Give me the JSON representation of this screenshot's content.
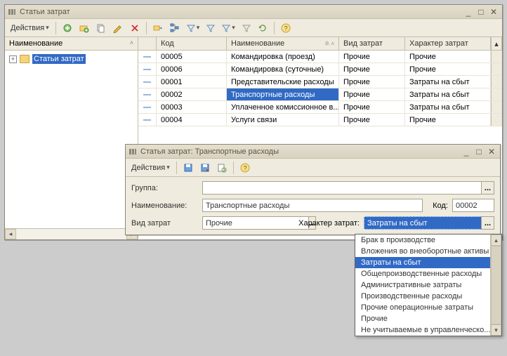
{
  "mainWindow": {
    "title": "Статьи затрат",
    "actionsLabel": "Действия",
    "tree": {
      "header": "Наименование",
      "root": "Статьи затрат"
    },
    "grid": {
      "columns": {
        "code": "Код",
        "name": "Наименование",
        "type": "Вид затрат",
        "nature": "Характер затрат"
      },
      "rows": [
        {
          "code": "00005",
          "name": "Командировка (проезд)",
          "type": "Прочие",
          "nature": "Прочие"
        },
        {
          "code": "00006",
          "name": "Командировка (суточные)",
          "type": "Прочие",
          "nature": "Прочие"
        },
        {
          "code": "00001",
          "name": "Представительские расходы",
          "type": "Прочие",
          "nature": "Затраты на сбыт"
        },
        {
          "code": "00002",
          "name": "Транспортные расходы",
          "type": "Прочие",
          "nature": "Затраты на сбыт"
        },
        {
          "code": "00003",
          "name": "Уплаченное комиссионное в...",
          "type": "Прочие",
          "nature": "Затраты на сбыт"
        },
        {
          "code": "00004",
          "name": "Услуги связи",
          "type": "Прочие",
          "nature": "Прочие"
        }
      ],
      "selectedIndex": 3
    }
  },
  "detailWindow": {
    "title": "Статья затрат: Транспортные расходы",
    "actionsLabel": "Действия",
    "labels": {
      "group": "Группа:",
      "name": "Наименование:",
      "code": "Код:",
      "type": "Вид затрат",
      "nature": "Характер затрат:"
    },
    "values": {
      "group": "",
      "name": "Транспортные расходы",
      "code": "00002",
      "type": "Прочие",
      "nature": "Затраты на сбыт"
    },
    "dropdown": {
      "items": [
        "Брак в производстве",
        "Вложения во внеоборотные активы",
        "Затраты на сбыт",
        "Общепроизводственные расходы",
        "Административные затраты",
        "Производственные расходы",
        "Прочие операционные затраты",
        "Прочие",
        "Не учитываемые в управленческо..."
      ],
      "highlightIndex": 2
    }
  },
  "colors": {
    "selection": "#316ac5"
  }
}
